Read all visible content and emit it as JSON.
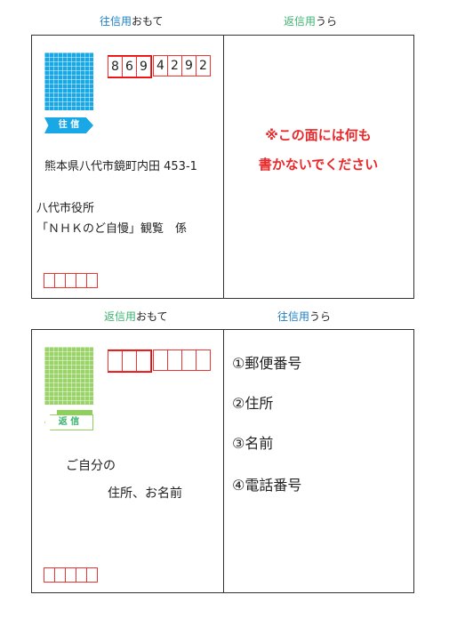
{
  "top": {
    "front_title": {
      "colored": "往信用",
      "rest": "おもて"
    },
    "back_title": {
      "colored": "返信用",
      "rest": "うら"
    },
    "badge": "往 信",
    "zip_digits": [
      "8",
      "6",
      "9",
      "4",
      "2",
      "9",
      "2"
    ],
    "address": "熊本県八代市鏡町内田 453-1",
    "recipient_line1": "八代市役所",
    "recipient_line2": "「ＮＨＫのど自慢」観覧　係",
    "notice_line1": "※この面には何も",
    "notice_line2": "書かないでください"
  },
  "bottom": {
    "front_title": {
      "colored": "返信用",
      "rest": "おもて"
    },
    "back_title": {
      "colored": "往信用",
      "rest": "うら"
    },
    "badge": "返 信",
    "instruction_line1": "ご自分の",
    "instruction_line2": "住所、お名前",
    "items": [
      "①郵便番号",
      "②住所",
      "③名前",
      "④電話番号"
    ]
  },
  "colors": {
    "blue": "#1aa7e6",
    "green": "#8fd05a",
    "green_text": "#3cb371",
    "red": "#e8282a",
    "blue_text": "#1a7fc4"
  }
}
